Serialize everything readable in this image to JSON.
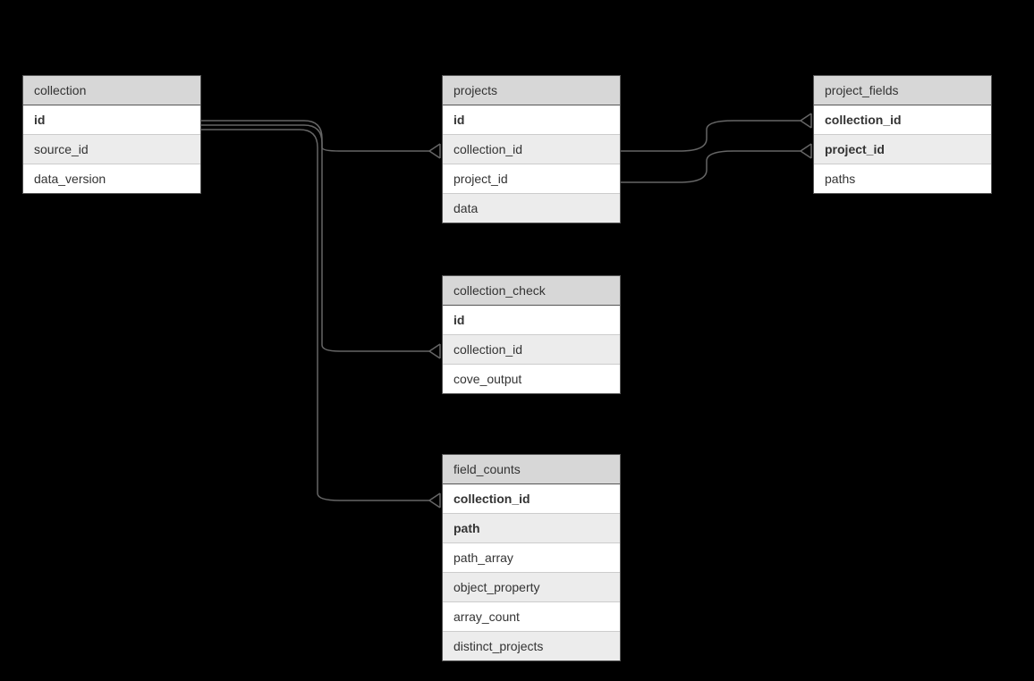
{
  "entities": {
    "collection": {
      "title": "collection",
      "rows": [
        {
          "label": "id",
          "bold": true,
          "alt": false
        },
        {
          "label": "source_id",
          "bold": false,
          "alt": true
        },
        {
          "label": "data_version",
          "bold": false,
          "alt": false
        }
      ]
    },
    "projects": {
      "title": "projects",
      "rows": [
        {
          "label": "id",
          "bold": true,
          "alt": false
        },
        {
          "label": "collection_id",
          "bold": false,
          "alt": true
        },
        {
          "label": "project_id",
          "bold": false,
          "alt": false
        },
        {
          "label": "data",
          "bold": false,
          "alt": true
        }
      ]
    },
    "project_fields": {
      "title": "project_fields",
      "rows": [
        {
          "label": "collection_id",
          "bold": true,
          "alt": false
        },
        {
          "label": "project_id",
          "bold": true,
          "alt": true
        },
        {
          "label": "paths",
          "bold": false,
          "alt": false
        }
      ]
    },
    "collection_check": {
      "title": "collection_check",
      "rows": [
        {
          "label": "id",
          "bold": true,
          "alt": false
        },
        {
          "label": "collection_id",
          "bold": false,
          "alt": true
        },
        {
          "label": "cove_output",
          "bold": false,
          "alt": false
        }
      ]
    },
    "field_counts": {
      "title": "field_counts",
      "rows": [
        {
          "label": "collection_id",
          "bold": true,
          "alt": false
        },
        {
          "label": "path",
          "bold": true,
          "alt": true
        },
        {
          "label": "path_array",
          "bold": false,
          "alt": false
        },
        {
          "label": "object_property",
          "bold": false,
          "alt": true
        },
        {
          "label": "array_count",
          "bold": false,
          "alt": false
        },
        {
          "label": "distinct_projects",
          "bold": false,
          "alt": true
        }
      ]
    }
  }
}
